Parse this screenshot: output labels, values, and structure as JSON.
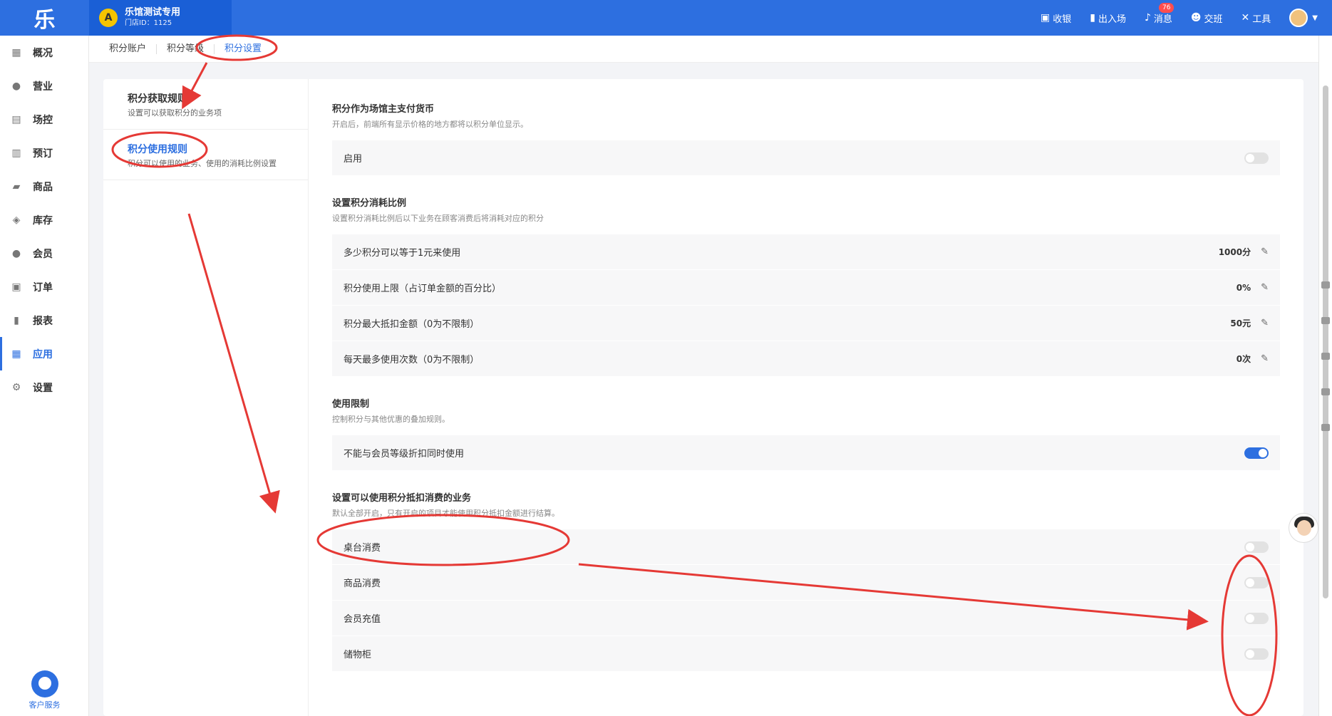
{
  "app": {
    "logo_text": "乐"
  },
  "store": {
    "name": "乐馆测试专用",
    "id_text": "门店ID：1125",
    "avatar_letter": "A"
  },
  "topbar": {
    "actions": [
      {
        "label": "收银",
        "icon": "cashier-icon",
        "glyph": "▣"
      },
      {
        "label": "出入场",
        "icon": "door-icon",
        "glyph": "▮"
      },
      {
        "label": "消息",
        "icon": "bell-icon",
        "glyph": "♪",
        "badge": "76"
      },
      {
        "label": "交班",
        "icon": "handover-icon",
        "glyph": "☻"
      },
      {
        "label": "工具",
        "icon": "tools-icon",
        "glyph": "✕"
      }
    ]
  },
  "sidebar": {
    "items": [
      {
        "label": "概况",
        "icon": "chart-icon",
        "glyph": "▦"
      },
      {
        "label": "营业",
        "icon": "moneybag-icon",
        "glyph": "●"
      },
      {
        "label": "场控",
        "icon": "venue-icon",
        "glyph": "▤"
      },
      {
        "label": "预订",
        "icon": "calendar-icon",
        "glyph": "▥"
      },
      {
        "label": "商品",
        "icon": "cart-icon",
        "glyph": "▰"
      },
      {
        "label": "库存",
        "icon": "layers-icon",
        "glyph": "◈"
      },
      {
        "label": "会员",
        "icon": "members-icon",
        "glyph": "●"
      },
      {
        "label": "订单",
        "icon": "order-icon",
        "glyph": "▣"
      },
      {
        "label": "报表",
        "icon": "report-icon",
        "glyph": "▮"
      },
      {
        "label": "应用",
        "icon": "apps-icon",
        "glyph": "▦"
      },
      {
        "label": "设置",
        "icon": "gear-icon",
        "glyph": "⚙"
      }
    ],
    "active_index": 9,
    "customer_service": "客户服务"
  },
  "tabs": {
    "items": [
      "积分账户",
      "积分等级",
      "积分设置"
    ],
    "active_index": 2
  },
  "rules": {
    "items": [
      {
        "title": "积分获取规则",
        "desc": "设置可以获取积分的业务项"
      },
      {
        "title": "积分使用规则",
        "desc": "积分可以使用的业务、使用的消耗比例设置"
      }
    ],
    "active_index": 1
  },
  "sections": [
    {
      "title": "积分作为场馆主支付货币",
      "desc": "开启后，前端所有显示价格的地方都将以积分单位显示。",
      "rows": [
        {
          "label": "启用",
          "toggle": false
        }
      ]
    },
    {
      "title": "设置积分消耗比例",
      "desc": "设置积分消耗比例后以下业务在顾客消费后将消耗对应的积分",
      "rows": [
        {
          "label": "多少积分可以等于1元来使用",
          "value": "1000分"
        },
        {
          "label": "积分使用上限（占订单金额的百分比）",
          "value": "0%"
        },
        {
          "label": "积分最大抵扣金额（0为不限制）",
          "value": "50元"
        },
        {
          "label": "每天最多使用次数（0为不限制）",
          "value": "0次"
        }
      ]
    },
    {
      "title": "使用限制",
      "desc": "控制积分与其他优惠的叠加规则。",
      "rows": [
        {
          "label": "不能与会员等级折扣同时使用",
          "toggle": true
        }
      ]
    },
    {
      "title": "设置可以使用积分抵扣消费的业务",
      "desc": "默认全部开启，只有开启的项目才能使用积分抵扣金额进行结算。",
      "rows": [
        {
          "label": "桌台消费",
          "toggle": false
        },
        {
          "label": "商品消费",
          "toggle": false
        },
        {
          "label": "会员充值",
          "toggle": false
        },
        {
          "label": "储物柜",
          "toggle": false
        }
      ]
    }
  ],
  "colors": {
    "primary": "#2d6fe0",
    "annotation": "#e53935"
  }
}
